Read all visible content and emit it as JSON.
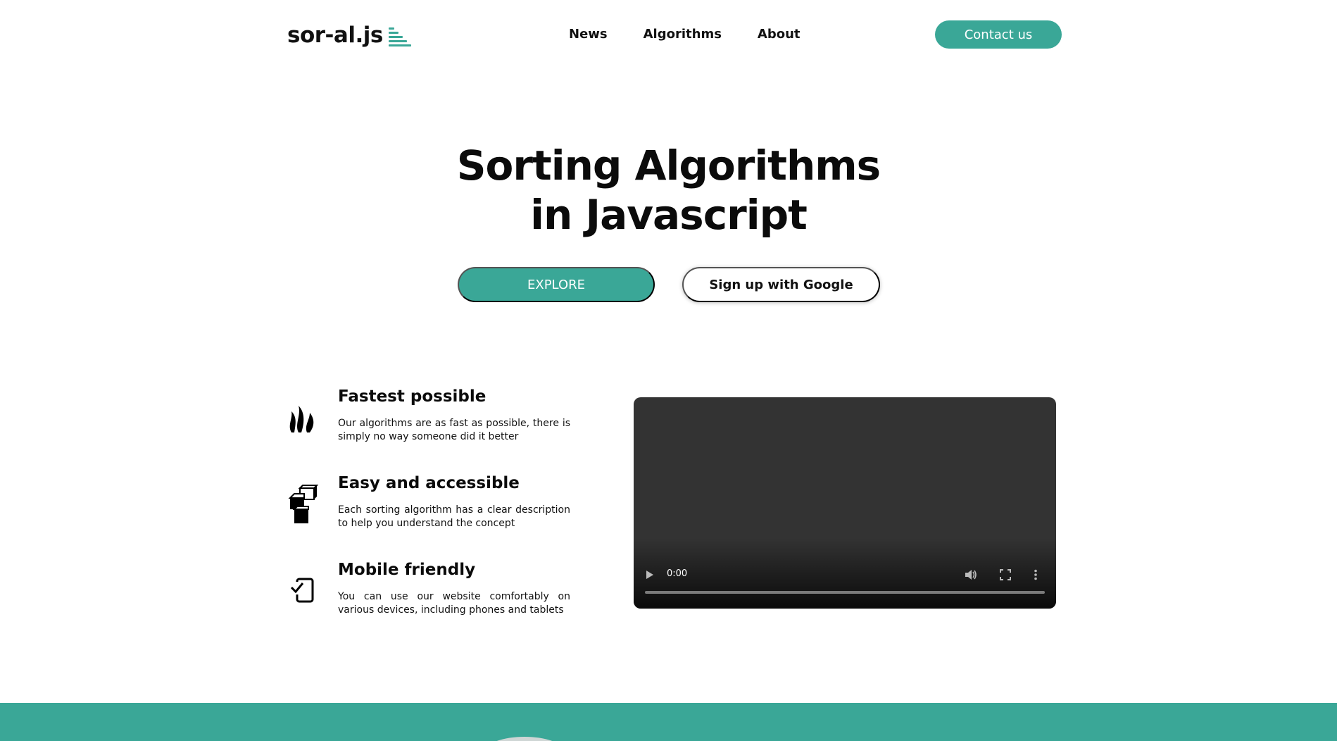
{
  "header": {
    "logo_text": "sor-al.js",
    "nav": [
      "News",
      "Algorithms",
      "About"
    ],
    "contact_label": "Contact us"
  },
  "hero": {
    "title_line1": "Sorting Algorithms",
    "title_line2": "in Javascript",
    "explore_label": "EXPLORE",
    "google_label": "Sign up with Google"
  },
  "features": [
    {
      "icon": "flame-icon",
      "title": "Fastest possible",
      "desc": "Our algorithms are as fast as possible, there is simply no way someone did it better"
    },
    {
      "icon": "cubes-icon",
      "title": "Easy and accessible",
      "desc": "Each sorting algorithm has a clear description to help you understand the concept"
    },
    {
      "icon": "mobile-check-icon",
      "title": "Mobile friendly",
      "desc": "You can use our website comfortably on various devices, including phones and tablets"
    }
  ],
  "video": {
    "time": "0:00"
  },
  "colors": {
    "accent": "#3aa797",
    "video_bg": "#333333"
  }
}
